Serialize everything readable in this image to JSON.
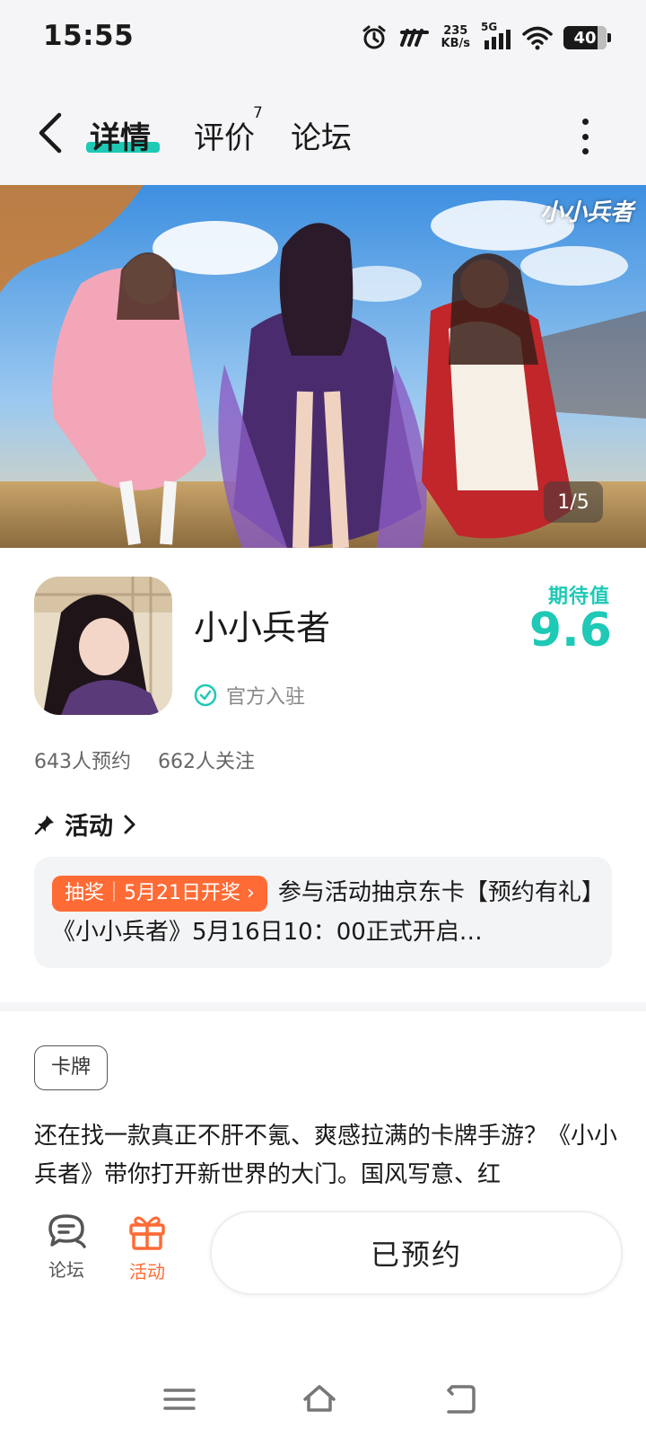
{
  "status_bar": {
    "time": "15:55",
    "net_speed_value": "235",
    "net_speed_unit": "KB/s",
    "network": "5G",
    "battery": "40",
    "icons": [
      "alarm-icon",
      "app-notification-icon",
      "signal-icon",
      "wifi-icon",
      "battery-icon"
    ]
  },
  "nav": {
    "tabs": [
      {
        "label": "详情",
        "active": true
      },
      {
        "label": "评价",
        "badge": "7"
      },
      {
        "label": "论坛"
      }
    ],
    "icons": [
      "back-icon",
      "more-icon"
    ]
  },
  "banner": {
    "logo_text": "小小兵者",
    "pager": "1/5"
  },
  "game": {
    "name": "小小兵者",
    "verified_label": "官方入驻",
    "expect_label": "期待值",
    "expect_value": "9.6",
    "reservations": "643人预约",
    "followers": "662人关注"
  },
  "activity": {
    "title": "活动",
    "badge": "抽奖｜5月21日开奖",
    "text": "参与活动抽京东卡【预约有礼】《小小兵者》5月16日10：00正式开启…"
  },
  "description": {
    "tag": "卡牌",
    "text": "还在找一款真正不肝不氪、爽感拉满的卡牌手游？《小小兵者》带你打开新世界的大门。国风写意、红"
  },
  "action_bar": {
    "forum_label": "论坛",
    "activity_label": "活动",
    "reserve_label": "已预约"
  },
  "colors": {
    "accent": "#1ec9b5",
    "orange": "#ff6b35",
    "background": "#f5f5f7"
  }
}
